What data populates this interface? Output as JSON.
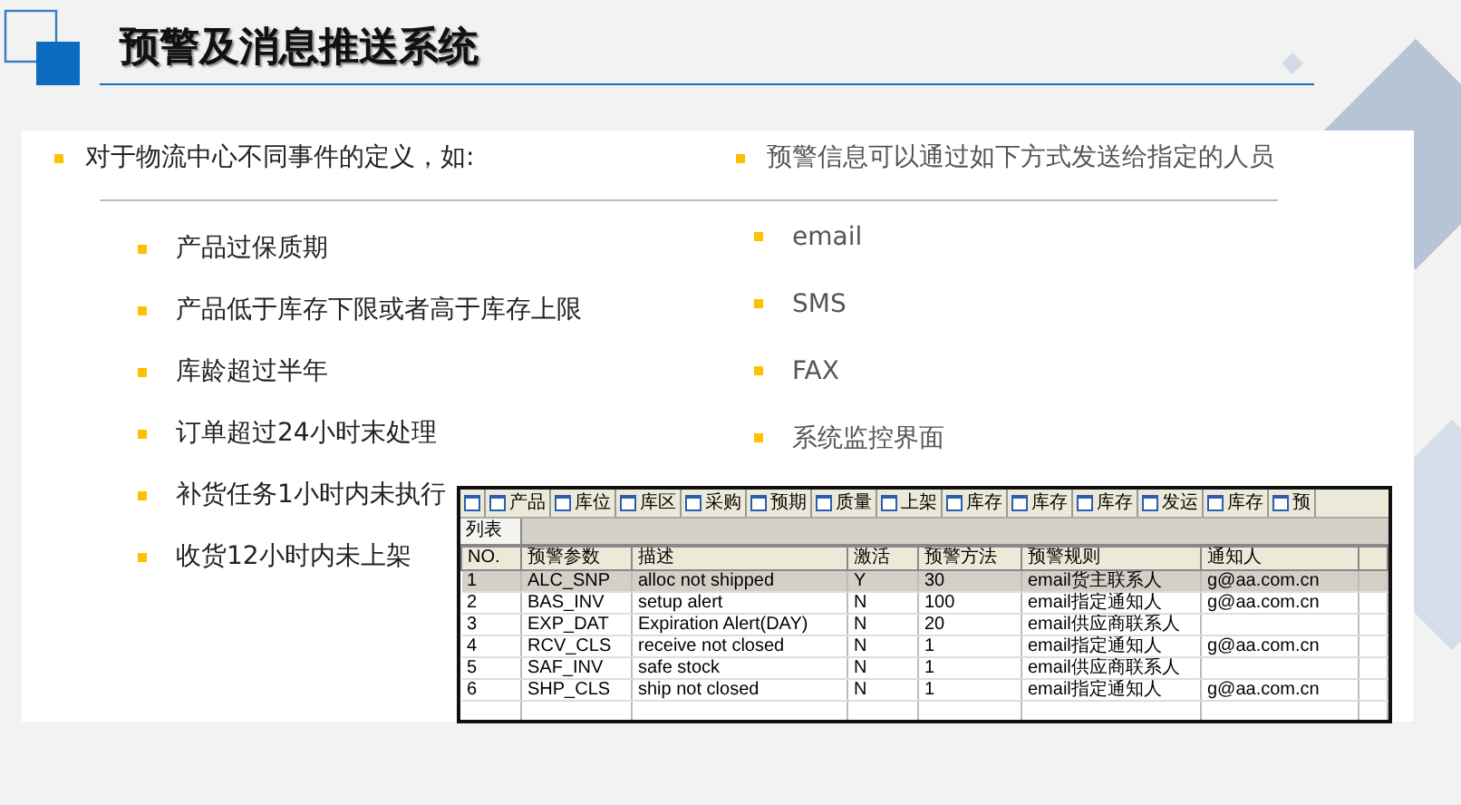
{
  "slide": {
    "title": "预警及消息推送系统"
  },
  "left": {
    "heading": "对于物流中心不同事件的定义，如:",
    "items": [
      "产品过保质期",
      "产品低于库存下限或者高于库存上限",
      "库龄超过半年",
      "订单超过24小时末处理",
      "补货任务1小时内未执行",
      "收货12小时内未上架"
    ]
  },
  "right": {
    "heading": "预警信息可以通过如下方式发送给指定的人员",
    "items": [
      "email",
      "SMS",
      "FAX",
      "系统监控界面"
    ]
  },
  "screenshot": {
    "tabs": [
      "产品",
      "库位",
      "库区",
      "采购",
      "预期",
      "质量",
      "上架",
      "库存",
      "库存",
      "库存",
      "发运",
      "库存",
      "预"
    ],
    "subtab": "列表",
    "columns": [
      "NO.",
      "预警参数",
      "描述",
      "激活",
      "预警方法",
      "预警规则",
      "通知人"
    ],
    "rows": [
      {
        "no": "1",
        "param": "ALC_SNP",
        "desc": "alloc not shipped",
        "active": "Y",
        "method": "30",
        "rule": "email货主联系人",
        "notify": "g@aa.com.cn",
        "selected": true
      },
      {
        "no": "2",
        "param": "BAS_INV",
        "desc": "setup alert",
        "active": "N",
        "method": "100",
        "rule": "email指定通知人",
        "notify": "g@aa.com.cn",
        "selected": false
      },
      {
        "no": "3",
        "param": "EXP_DAT",
        "desc": "Expiration Alert(DAY)",
        "active": "N",
        "method": "20",
        "rule": "email供应商联系人",
        "selected": false
      },
      {
        "no": "4",
        "param": "RCV_CLS",
        "desc": "receive not closed",
        "active": "N",
        "method": "1",
        "rule": "email指定通知人",
        "notify": "g@aa.com.cn",
        "selected": false
      },
      {
        "no": "5",
        "param": "SAF_INV",
        "desc": "safe stock",
        "active": "N",
        "method": "1",
        "rule": "email供应商联系人",
        "selected": false
      },
      {
        "no": "6",
        "param": "SHP_CLS",
        "desc": "ship not closed",
        "active": "N",
        "method": "1",
        "rule": "email指定通知人",
        "notify": "g@aa.com.cn",
        "selected": false
      }
    ]
  }
}
